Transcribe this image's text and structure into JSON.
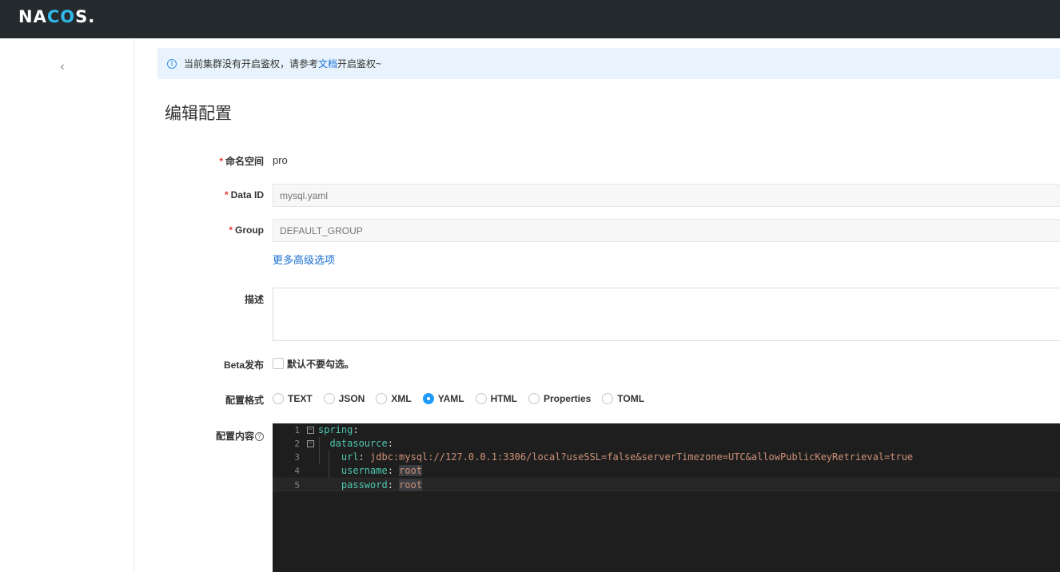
{
  "header": {
    "logo": {
      "left": "NA",
      "accent": "CO",
      "right": "S."
    }
  },
  "sidebar": {
    "collapse_glyph": "‹"
  },
  "notice": {
    "prefix": "当前集群没有开启鉴权，请参考",
    "link": "文档",
    "suffix": "开启鉴权~"
  },
  "page": {
    "title": "编辑配置"
  },
  "form": {
    "namespace": {
      "label": "命名空间",
      "value": "pro"
    },
    "data_id": {
      "label": "Data ID",
      "placeholder": "mysql.yaml"
    },
    "group": {
      "label": "Group",
      "placeholder": "DEFAULT_GROUP"
    },
    "advanced_link": "更多高级选项",
    "description": {
      "label": "描述"
    },
    "beta": {
      "label": "Beta发布",
      "checkbox_label": "默认不要勾选。"
    },
    "format": {
      "label": "配置格式",
      "options": [
        "TEXT",
        "JSON",
        "XML",
        "YAML",
        "HTML",
        "Properties",
        "TOML"
      ],
      "selected": "YAML"
    },
    "content": {
      "label": "配置内容"
    }
  },
  "editor": {
    "lines": [
      {
        "n": "1",
        "fold": "⊟",
        "key": "spring",
        "sep": ":",
        "val": ""
      },
      {
        "n": "2",
        "fold": "⊟",
        "indent": "  ",
        "key": "datasource",
        "sep": ":",
        "val": ""
      },
      {
        "n": "3",
        "fold": "",
        "indent": "    ",
        "key": "url",
        "sep": ": ",
        "val": "jdbc:mysql://127.0.0.1:3306/local?useSSL=false&serverTimezone=UTC&allowPublicKeyRetrieval=true"
      },
      {
        "n": "4",
        "fold": "",
        "indent": "    ",
        "key": "username",
        "sep": ": ",
        "val": "root"
      },
      {
        "n": "5",
        "fold": "",
        "indent": "    ",
        "key": "password",
        "sep": ": ",
        "val": "root"
      }
    ]
  },
  "colors": {
    "topbar": "#252a2f",
    "accent": "#209bfa",
    "link": "#1a6fd1",
    "required": "#e53935",
    "editor_bg": "#1e1e1e"
  }
}
